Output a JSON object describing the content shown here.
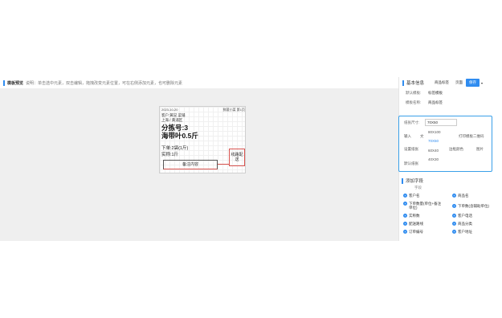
{
  "hint": {
    "title": "模板预览",
    "desc": "说明：单击选中元素，双击编辑，拖拽改变元素位置，可在右侧添加元素，也可删除元素"
  },
  "label": {
    "top_left": "2023-10-20",
    "top_right": "鲜蔬小菜 第1页",
    "line1": "客户:黄記 菜铺",
    "line2": "上海 / 黄浦区",
    "line3": "分拣号:3",
    "line4": "海带叶0.5斤",
    "line5": "下单:2袋(1斤)",
    "line6": "实称:1斤",
    "box": "备注内容",
    "qr": "线路配送"
  },
  "panel": {
    "title": "基本信息",
    "tabs": [
      "商品标签",
      "页面",
      "保存"
    ],
    "rows": [
      {
        "label": "默认模板:",
        "value": "标签模板"
      },
      {
        "label": "模板名称:",
        "value": "商品标签"
      }
    ],
    "size": {
      "label": "纸张尺寸:",
      "value": "70X50",
      "left": [
        "输入",
        "设置纸张",
        "默认纸张"
      ],
      "mid_text": "文",
      "options": [
        "80X100",
        "70X50",
        "60X40",
        "40X30"
      ],
      "right": [
        "打印模板二维码",
        "边框颜色",
        "图片"
      ]
    }
  },
  "fields": {
    "title": "添加字段",
    "sub": "字段",
    "left": [
      "客户名",
      "下单数量(单位+备注单位)",
      "实称数",
      "配送路线",
      "订单编号"
    ],
    "right": [
      "商品名",
      "下单数(含辅助单位)",
      "客户电话",
      "商品分类",
      "客户地址"
    ]
  }
}
